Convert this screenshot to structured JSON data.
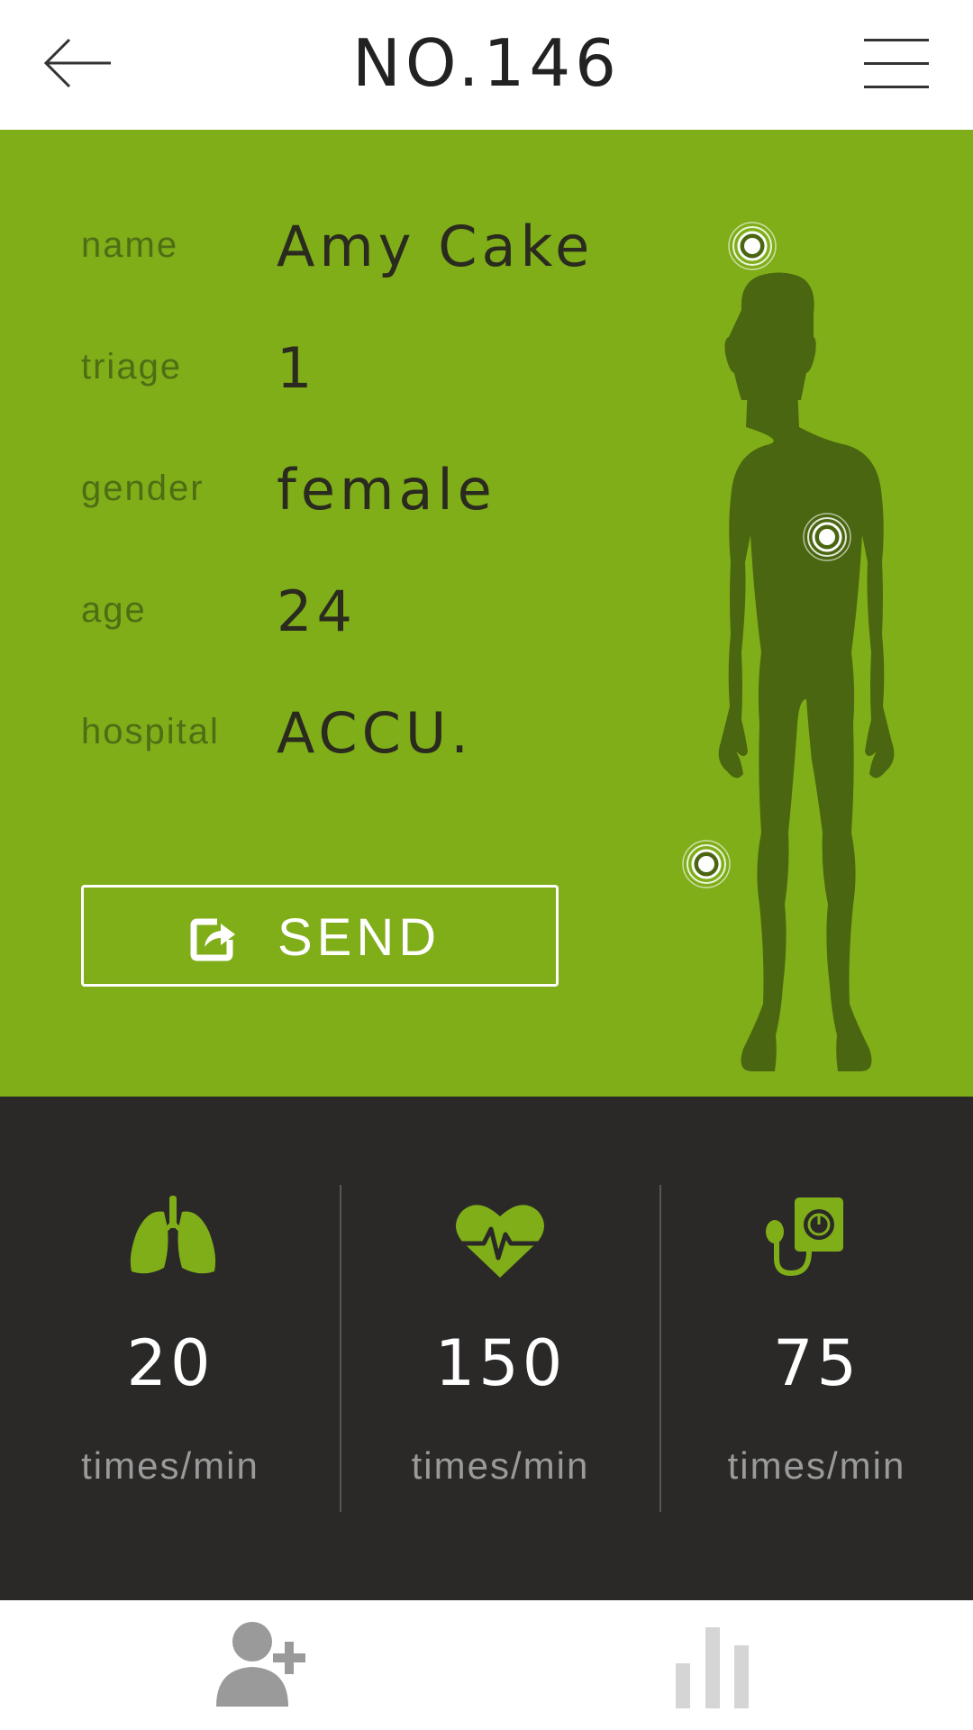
{
  "header": {
    "title": "NO.146",
    "back_icon": "arrow-left-icon",
    "menu_icon": "hamburger-menu-icon"
  },
  "patient": {
    "fields": [
      {
        "label": "name",
        "value": "Amy Cake"
      },
      {
        "label": "triage",
        "value": "1"
      },
      {
        "label": "gender",
        "value": "female"
      },
      {
        "label": "age",
        "value": "24"
      },
      {
        "label": "hospital",
        "value": "ACCU."
      }
    ],
    "send_label": "SEND",
    "send_icon": "share-icon",
    "body_icon": "human-body-silhouette",
    "injury_markers": [
      "head",
      "right-hip",
      "left-knee"
    ]
  },
  "vitals": [
    {
      "icon": "lungs-icon",
      "value": "20",
      "unit": "times/min"
    },
    {
      "icon": "heart-rate-icon",
      "value": "150",
      "unit": "times/min"
    },
    {
      "icon": "blood-pressure-monitor-icon",
      "value": "75",
      "unit": "times/min"
    }
  ],
  "nav": {
    "items": [
      {
        "icon": "add-person-icon",
        "active": true
      },
      {
        "icon": "bar-chart-icon",
        "active": false
      }
    ]
  },
  "colors": {
    "accent_green": "#7fae19",
    "dark_green": "#4a6610",
    "dark_panel": "#2a2928",
    "white": "#ffffff"
  }
}
